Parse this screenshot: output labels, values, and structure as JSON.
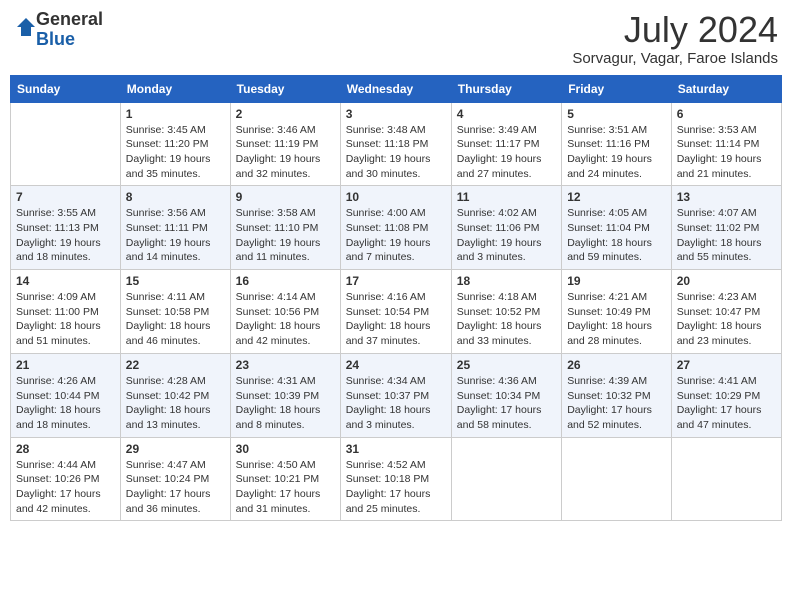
{
  "logo": {
    "general": "General",
    "blue": "Blue"
  },
  "header": {
    "month_year": "July 2024",
    "location": "Sorvagur, Vagar, Faroe Islands"
  },
  "days_of_week": [
    "Sunday",
    "Monday",
    "Tuesday",
    "Wednesday",
    "Thursday",
    "Friday",
    "Saturday"
  ],
  "weeks": [
    [
      {
        "day": "",
        "detail": ""
      },
      {
        "day": "1",
        "detail": "Sunrise: 3:45 AM\nSunset: 11:20 PM\nDaylight: 19 hours\nand 35 minutes."
      },
      {
        "day": "2",
        "detail": "Sunrise: 3:46 AM\nSunset: 11:19 PM\nDaylight: 19 hours\nand 32 minutes."
      },
      {
        "day": "3",
        "detail": "Sunrise: 3:48 AM\nSunset: 11:18 PM\nDaylight: 19 hours\nand 30 minutes."
      },
      {
        "day": "4",
        "detail": "Sunrise: 3:49 AM\nSunset: 11:17 PM\nDaylight: 19 hours\nand 27 minutes."
      },
      {
        "day": "5",
        "detail": "Sunrise: 3:51 AM\nSunset: 11:16 PM\nDaylight: 19 hours\nand 24 minutes."
      },
      {
        "day": "6",
        "detail": "Sunrise: 3:53 AM\nSunset: 11:14 PM\nDaylight: 19 hours\nand 21 minutes."
      }
    ],
    [
      {
        "day": "7",
        "detail": "Sunrise: 3:55 AM\nSunset: 11:13 PM\nDaylight: 19 hours\nand 18 minutes."
      },
      {
        "day": "8",
        "detail": "Sunrise: 3:56 AM\nSunset: 11:11 PM\nDaylight: 19 hours\nand 14 minutes."
      },
      {
        "day": "9",
        "detail": "Sunrise: 3:58 AM\nSunset: 11:10 PM\nDaylight: 19 hours\nand 11 minutes."
      },
      {
        "day": "10",
        "detail": "Sunrise: 4:00 AM\nSunset: 11:08 PM\nDaylight: 19 hours\nand 7 minutes."
      },
      {
        "day": "11",
        "detail": "Sunrise: 4:02 AM\nSunset: 11:06 PM\nDaylight: 19 hours\nand 3 minutes."
      },
      {
        "day": "12",
        "detail": "Sunrise: 4:05 AM\nSunset: 11:04 PM\nDaylight: 18 hours\nand 59 minutes."
      },
      {
        "day": "13",
        "detail": "Sunrise: 4:07 AM\nSunset: 11:02 PM\nDaylight: 18 hours\nand 55 minutes."
      }
    ],
    [
      {
        "day": "14",
        "detail": "Sunrise: 4:09 AM\nSunset: 11:00 PM\nDaylight: 18 hours\nand 51 minutes."
      },
      {
        "day": "15",
        "detail": "Sunrise: 4:11 AM\nSunset: 10:58 PM\nDaylight: 18 hours\nand 46 minutes."
      },
      {
        "day": "16",
        "detail": "Sunrise: 4:14 AM\nSunset: 10:56 PM\nDaylight: 18 hours\nand 42 minutes."
      },
      {
        "day": "17",
        "detail": "Sunrise: 4:16 AM\nSunset: 10:54 PM\nDaylight: 18 hours\nand 37 minutes."
      },
      {
        "day": "18",
        "detail": "Sunrise: 4:18 AM\nSunset: 10:52 PM\nDaylight: 18 hours\nand 33 minutes."
      },
      {
        "day": "19",
        "detail": "Sunrise: 4:21 AM\nSunset: 10:49 PM\nDaylight: 18 hours\nand 28 minutes."
      },
      {
        "day": "20",
        "detail": "Sunrise: 4:23 AM\nSunset: 10:47 PM\nDaylight: 18 hours\nand 23 minutes."
      }
    ],
    [
      {
        "day": "21",
        "detail": "Sunrise: 4:26 AM\nSunset: 10:44 PM\nDaylight: 18 hours\nand 18 minutes."
      },
      {
        "day": "22",
        "detail": "Sunrise: 4:28 AM\nSunset: 10:42 PM\nDaylight: 18 hours\nand 13 minutes."
      },
      {
        "day": "23",
        "detail": "Sunrise: 4:31 AM\nSunset: 10:39 PM\nDaylight: 18 hours\nand 8 minutes."
      },
      {
        "day": "24",
        "detail": "Sunrise: 4:34 AM\nSunset: 10:37 PM\nDaylight: 18 hours\nand 3 minutes."
      },
      {
        "day": "25",
        "detail": "Sunrise: 4:36 AM\nSunset: 10:34 PM\nDaylight: 17 hours\nand 58 minutes."
      },
      {
        "day": "26",
        "detail": "Sunrise: 4:39 AM\nSunset: 10:32 PM\nDaylight: 17 hours\nand 52 minutes."
      },
      {
        "day": "27",
        "detail": "Sunrise: 4:41 AM\nSunset: 10:29 PM\nDaylight: 17 hours\nand 47 minutes."
      }
    ],
    [
      {
        "day": "28",
        "detail": "Sunrise: 4:44 AM\nSunset: 10:26 PM\nDaylight: 17 hours\nand 42 minutes."
      },
      {
        "day": "29",
        "detail": "Sunrise: 4:47 AM\nSunset: 10:24 PM\nDaylight: 17 hours\nand 36 minutes."
      },
      {
        "day": "30",
        "detail": "Sunrise: 4:50 AM\nSunset: 10:21 PM\nDaylight: 17 hours\nand 31 minutes."
      },
      {
        "day": "31",
        "detail": "Sunrise: 4:52 AM\nSunset: 10:18 PM\nDaylight: 17 hours\nand 25 minutes."
      },
      {
        "day": "",
        "detail": ""
      },
      {
        "day": "",
        "detail": ""
      },
      {
        "day": "",
        "detail": ""
      }
    ]
  ]
}
